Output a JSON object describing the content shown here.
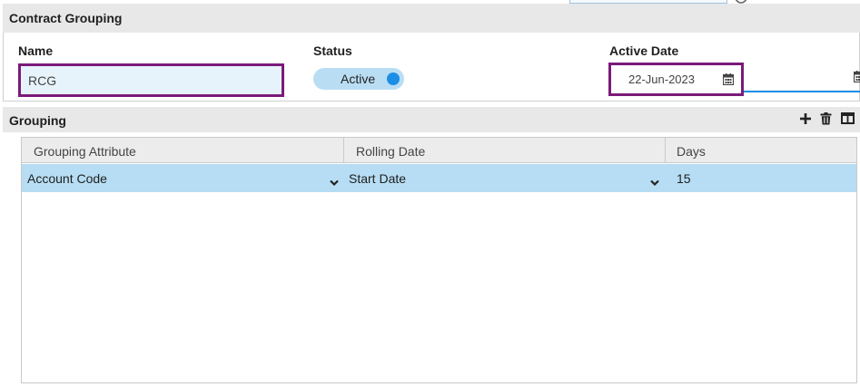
{
  "contract_grouping": {
    "title": "Contract Grouping",
    "name_label": "Name",
    "name_value": "RCG",
    "status_label": "Status",
    "status_value": "Active",
    "active_date_label": "Active Date",
    "active_date_value": "22-Jun-2023"
  },
  "grouping": {
    "title": "Grouping",
    "toolbar_icons": [
      "plus-icon",
      "trash-icon",
      "columns-icon"
    ],
    "columns": [
      "Grouping Attribute",
      "Rolling Date",
      "Days"
    ],
    "rows": [
      {
        "grouping_attribute": "Account Code",
        "rolling_date": "Start Date",
        "days": "15"
      }
    ]
  },
  "colors": {
    "highlight_border": "#7b1a7a",
    "toggle_bg": "#b9def4",
    "accent": "#1b8ee6",
    "selected_row": "#b6ddf3"
  }
}
